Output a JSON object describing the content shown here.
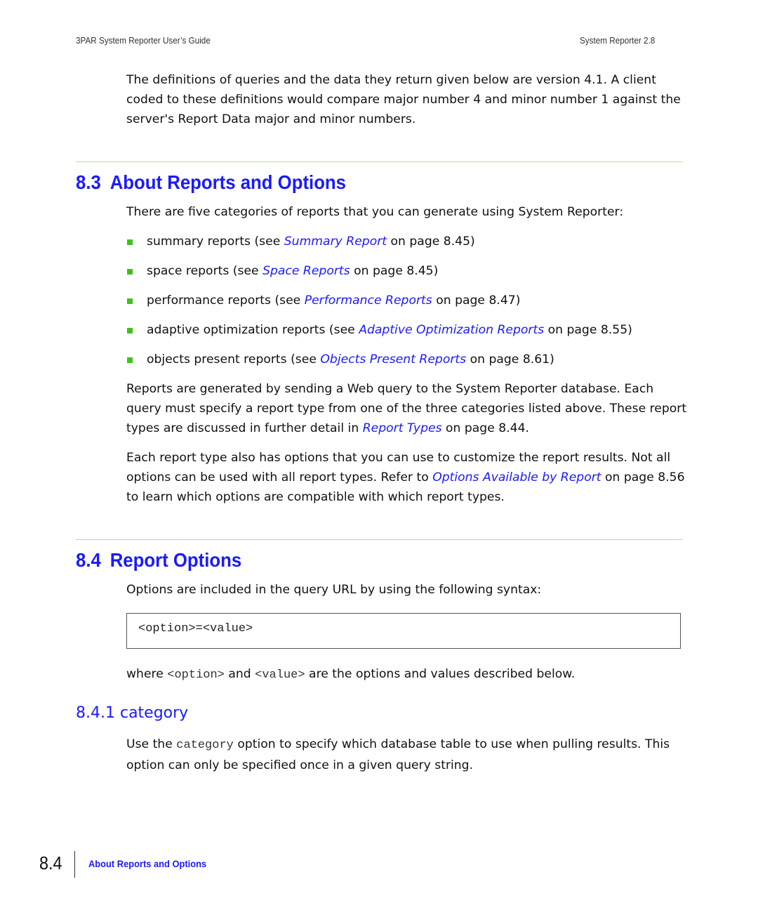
{
  "header": {
    "left": "3PAR System Reporter User’s Guide",
    "right": "System Reporter 2.8"
  },
  "intro": {
    "text": "The definitions of queries and the data they return given below are version 4.1. A client coded to these definitions would compare major number 4 and minor number 1 against the server's Report Data major and minor numbers."
  },
  "section_8_3": {
    "number": "8.3",
    "title": "About Reports and Options",
    "lead": "There are five categories of reports that you can generate using System Reporter:",
    "bullets": [
      {
        "pre": "summary reports (see ",
        "link": "Summary Report",
        "post": " on page 8.45)"
      },
      {
        "pre": "space reports (see ",
        "link": "Space Reports",
        "post": " on page 8.45)"
      },
      {
        "pre": "performance reports (see ",
        "link": "Performance Reports",
        "post": " on page 8.47)"
      },
      {
        "pre": "adaptive optimization reports (see ",
        "link": "Adaptive Optimization Reports",
        "post": " on page 8.55)"
      },
      {
        "pre": "objects present reports (see ",
        "link": "Objects Present Reports",
        "post": " on page 8.61)"
      }
    ],
    "para2": {
      "pre": "Reports are generated by sending a Web query to the System Reporter database. Each query must specify a report type from one of the three categories listed above. These report types are discussed in further detail in ",
      "link": "Report Types",
      "post": " on page 8.44."
    },
    "para3": {
      "pre": "Each report type also has options that you can use to customize the report results. Not all options can be used with all report types. Refer to ",
      "link": "Options Available by Report",
      "post": " on page 8.56 to learn which options are compatible with which report types."
    }
  },
  "section_8_4": {
    "number": "8.4",
    "title": "Report Options",
    "lead": "Options are included in the query URL by using the following syntax:",
    "code": "<option>=<value>",
    "where": {
      "w1": "where ",
      "c1": "<option>",
      "w2": " and ",
      "c2": "<value>",
      "w3": " are the options and values described below."
    }
  },
  "section_8_4_1": {
    "title": "8.4.1 category",
    "p1": "Use the ",
    "code": "category",
    "p2": " option to specify which database table to use when pulling results. This option can only be specified once in a given query string."
  },
  "footer": {
    "page_number": "8.4",
    "section_title": "About Reports and Options"
  }
}
